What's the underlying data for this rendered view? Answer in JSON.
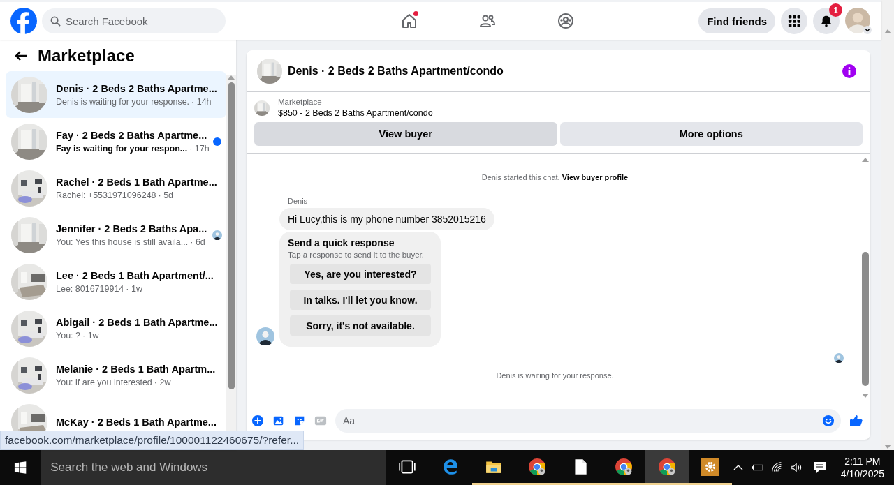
{
  "topbar": {
    "search": {
      "placeholder": "Search Facebook"
    },
    "nav": [
      {
        "kind": "home",
        "dot": true
      },
      {
        "kind": "friends",
        "dot": false
      },
      {
        "kind": "groups",
        "dot": false
      }
    ],
    "find_friends": "Find friends",
    "notification_count": "1"
  },
  "sidebar": {
    "title": "Marketplace",
    "conversations": [
      {
        "title": "Denis · 2 Beds 2 Baths Apartme...",
        "preview": "Denis is waiting for your response.",
        "time": "· 14h",
        "selected": true,
        "unread": false,
        "seen": false
      },
      {
        "title": "Fay · 2 Beds 2 Baths Apartme...",
        "preview": "Fay is waiting for your respon...",
        "time": "· 17h",
        "selected": false,
        "unread": true,
        "seen": false
      },
      {
        "title": "Rachel · 2 Beds 1 Bath Apartme...",
        "preview": "Rachel: +5531971096248",
        "time": "· 5d",
        "selected": false,
        "unread": false,
        "seen": false
      },
      {
        "title": "Jennifer · 2 Beds 2 Baths Apa...",
        "preview": "You: Yes this house is still availa...",
        "time": "· 6d",
        "selected": false,
        "unread": false,
        "seen": true
      },
      {
        "title": "Lee · 2 Beds 1 Bath Apartment/...",
        "preview": "Lee: 8016719914",
        "time": "· 1w",
        "selected": false,
        "unread": false,
        "seen": false
      },
      {
        "title": "Abigail · 2 Beds 1 Bath Apartme...",
        "preview": "You: ?",
        "time": "· 1w",
        "selected": false,
        "unread": false,
        "seen": false
      },
      {
        "title": "Melanie · 2 Beds 1 Bath Apartm...",
        "preview": "You: if are you interested",
        "time": "· 2w",
        "selected": false,
        "unread": false,
        "seen": false
      },
      {
        "title": "McKay · 2 Beds 1 Bath Apartme...",
        "selected": false
      }
    ]
  },
  "chat": {
    "title": "Denis · 2 Beds 2 Baths Apartment/condo",
    "listing": {
      "label": "Marketplace",
      "text": "$850 - 2 Beds 2 Baths Apartment/condo"
    },
    "actions": [
      {
        "label": "View buyer",
        "highlighted": true
      },
      {
        "label": "More options",
        "highlighted": false
      }
    ],
    "system_text": "Denis started this chat.",
    "system_link": "View buyer profile",
    "sender": "Denis",
    "message": "Hi Lucy,this is my phone number 3852015216",
    "quick": {
      "title": "Send a quick response",
      "subtitle": "Tap a response to send it to the buyer.",
      "options": [
        "Yes, are you interested?",
        "In talks. I'll let you know.",
        "Sorry, it's not available."
      ]
    },
    "footer": "Denis is waiting for your response.",
    "composer": {
      "placeholder": "Aa"
    }
  },
  "status_url": "facebook.com/marketplace/profile/100001122460675/?refer...",
  "taskbar": {
    "search": {
      "placeholder": "Search the web and Windows"
    },
    "apps": [
      {
        "kind": "taskview",
        "running": false,
        "active": false
      },
      {
        "kind": "edge",
        "running": false,
        "active": false
      },
      {
        "kind": "folder",
        "running": true,
        "active": false
      },
      {
        "kind": "chrome",
        "running": true,
        "active": false
      },
      {
        "kind": "file",
        "running": true,
        "active": false
      },
      {
        "kind": "chrome",
        "running": true,
        "active": false
      },
      {
        "kind": "chrome",
        "running": true,
        "active": true
      },
      {
        "kind": "gear",
        "running": true,
        "active": false
      }
    ],
    "time": "2:11 PM",
    "date": "4/10/2025"
  }
}
